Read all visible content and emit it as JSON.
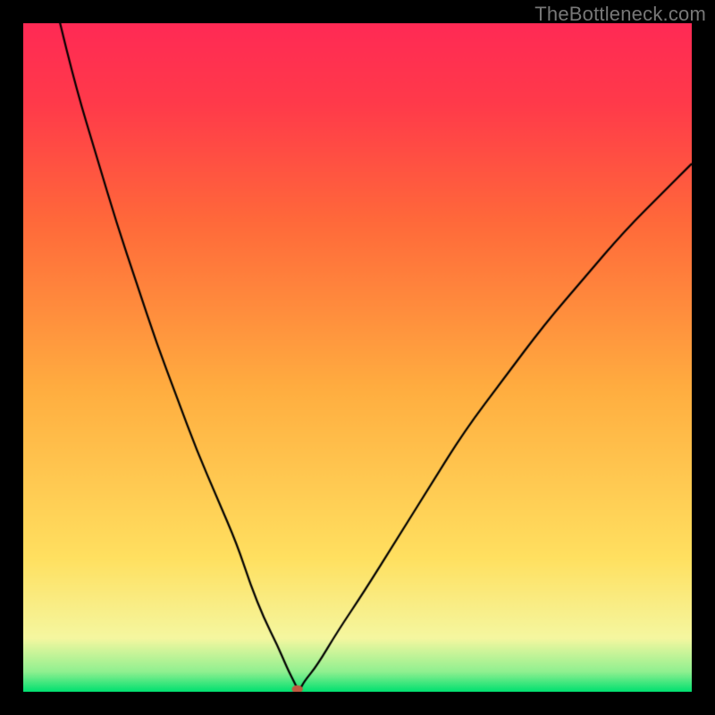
{
  "watermark": "TheBottleneck.com",
  "chart_data": {
    "type": "line",
    "title": "",
    "xlabel": "",
    "ylabel": "",
    "xlim": [
      0,
      100
    ],
    "ylim": [
      0,
      100
    ],
    "gradient_stops": [
      {
        "pos": 0.0,
        "color": "#00e070"
      },
      {
        "pos": 0.03,
        "color": "#90f090"
      },
      {
        "pos": 0.08,
        "color": "#f5f7a0"
      },
      {
        "pos": 0.2,
        "color": "#ffe060"
      },
      {
        "pos": 0.45,
        "color": "#ffae40"
      },
      {
        "pos": 0.7,
        "color": "#ff6a3a"
      },
      {
        "pos": 0.88,
        "color": "#ff3a4a"
      },
      {
        "pos": 1.0,
        "color": "#ff2a55"
      }
    ],
    "curve": {
      "x": [
        0,
        2,
        5,
        8,
        11,
        14,
        17,
        20,
        23,
        26,
        29,
        32,
        34,
        36,
        38,
        39.5,
        40.5,
        41,
        41.5,
        42,
        44,
        47,
        51,
        56,
        61,
        66,
        72,
        78,
        84,
        90,
        96,
        100
      ],
      "y": [
        128,
        115,
        102,
        90,
        80,
        70,
        61,
        52,
        44,
        36,
        29,
        22,
        16,
        11,
        7,
        3.5,
        1.5,
        0.5,
        0.5,
        1.5,
        4,
        9,
        15,
        23,
        31,
        39,
        47,
        55,
        62,
        69,
        75,
        79
      ]
    },
    "marker": {
      "x": 41,
      "y": 0.4,
      "rx": 3.8,
      "ry": 2.6,
      "color": "#c05a40"
    }
  }
}
